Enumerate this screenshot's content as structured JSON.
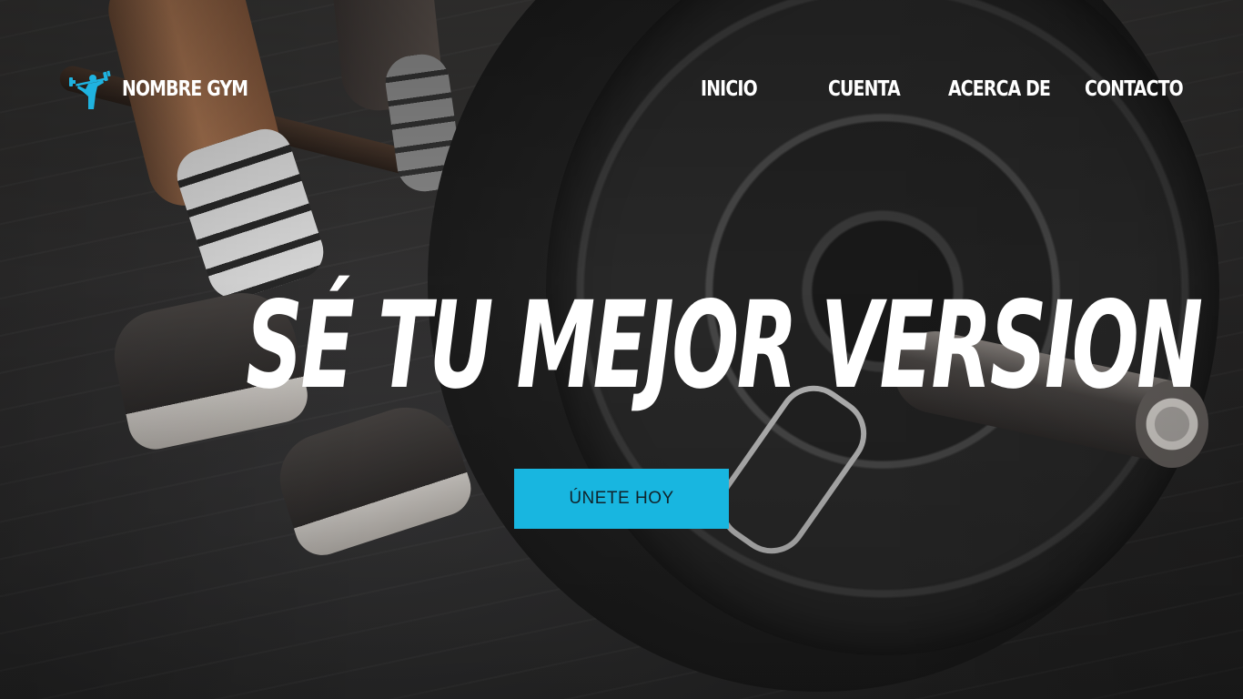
{
  "brand": {
    "name": "NOMBRE GYM",
    "icon": "weightlifter-icon",
    "icon_color": "#1fb3e0"
  },
  "nav": {
    "items": [
      {
        "label": "INICIO"
      },
      {
        "label": "CUENTA"
      },
      {
        "label": "ACERCA DE"
      },
      {
        "label": "CONTACTO"
      }
    ]
  },
  "hero": {
    "headline": "SÉ TU MEJOR VERSION",
    "cta_label": "ÚNETE HOY",
    "cta_color": "#18b6e0"
  }
}
